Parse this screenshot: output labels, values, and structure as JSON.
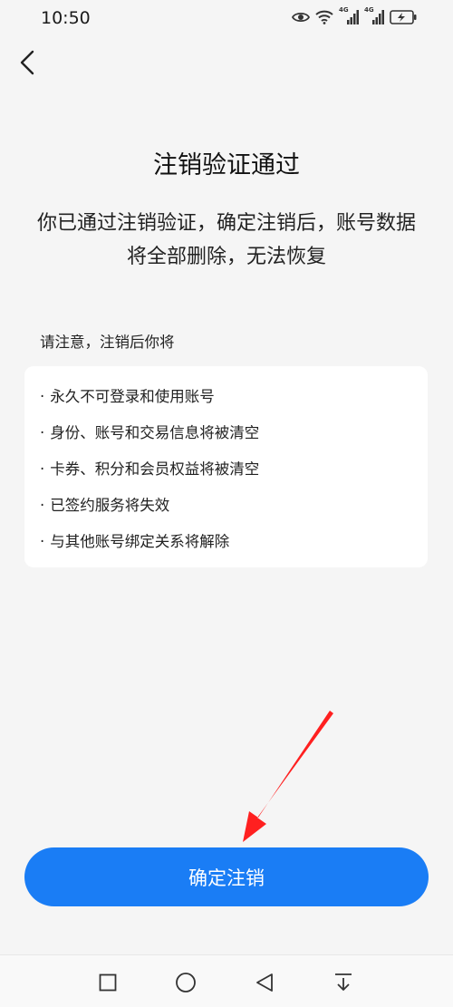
{
  "status_bar": {
    "time": "10:50",
    "icons": [
      "eye-icon",
      "wifi-icon",
      "signal-4g-icon",
      "signal-4g-icon",
      "battery-charging-icon"
    ],
    "network_label_1": "4G",
    "network_label_2": "4G"
  },
  "header": {
    "back_icon": "chevron-left-icon"
  },
  "main": {
    "title": "注销验证通过",
    "subtitle": "你已通过注销验证，确定注销后，账号数据将全部删除，无法恢复",
    "notice_label": "请注意，注销后你将",
    "bullet": "·",
    "notice_items": [
      "永久不可登录和使用账号",
      "身份、账号和交易信息将被清空",
      "卡券、积分和会员权益将被清空",
      "已签约服务将失效",
      "与其他账号绑定关系将解除"
    ]
  },
  "footer": {
    "confirm_label": "确定注销",
    "button_color": "#1a7df5"
  },
  "annotation": {
    "arrow_color": "#ff2020"
  },
  "nav_bar": {
    "icons": [
      "recents-square-icon",
      "home-circle-icon",
      "back-triangle-icon",
      "pull-down-icon"
    ]
  }
}
